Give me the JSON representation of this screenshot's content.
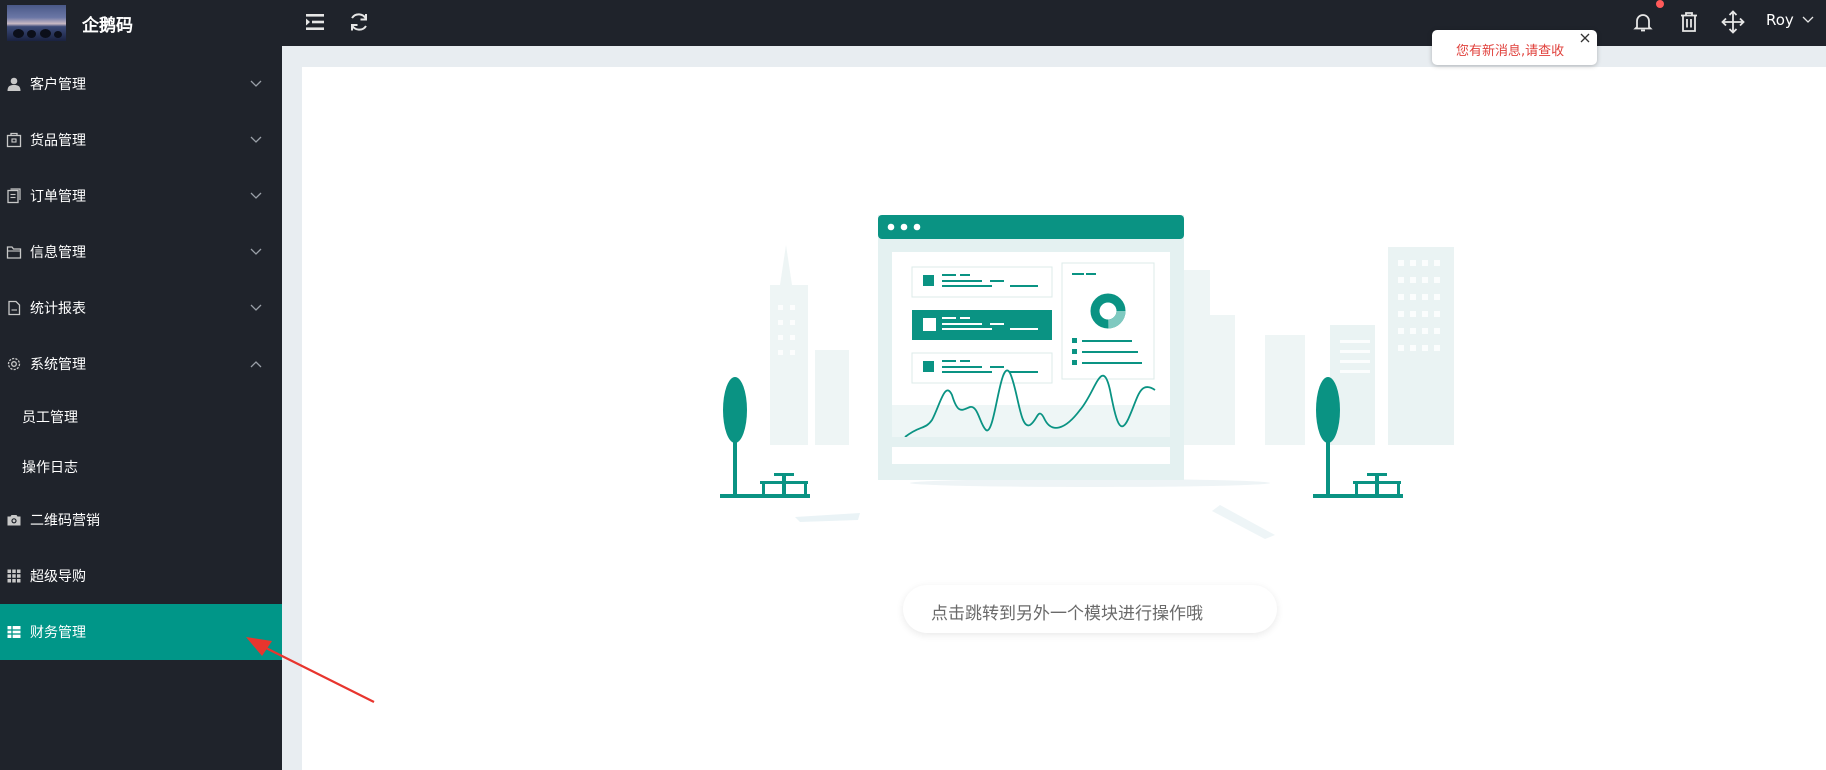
{
  "app": {
    "logo_title": "企鹅码"
  },
  "sidebar": {
    "items": [
      {
        "label": "客户管理",
        "icon": "user-icon",
        "expanded": false
      },
      {
        "label": "货品管理",
        "icon": "package-icon",
        "expanded": false
      },
      {
        "label": "订单管理",
        "icon": "order-icon",
        "expanded": false
      },
      {
        "label": "信息管理",
        "icon": "folder-icon",
        "expanded": false
      },
      {
        "label": "统计报表",
        "icon": "report-icon",
        "expanded": false
      },
      {
        "label": "系统管理",
        "icon": "gear-icon",
        "expanded": true,
        "children": [
          {
            "label": "员工管理"
          },
          {
            "label": "操作日志"
          }
        ]
      },
      {
        "label": "二维码营销",
        "icon": "camera-icon",
        "expanded": false
      },
      {
        "label": "超级导购",
        "icon": "grid-icon",
        "expanded": false
      },
      {
        "label": "财务管理",
        "icon": "table-icon",
        "expanded": false,
        "active": true
      }
    ]
  },
  "topbar": {
    "user_name": "Roy",
    "has_unread": true
  },
  "notice": {
    "text": "您有新消息,请查收"
  },
  "main": {
    "hint": "点击跳转到另外一个模块进行操作哦"
  },
  "colors": {
    "sidebar_bg": "#1f232b",
    "accent": "#009688",
    "notice_text": "#e0413c",
    "arrow": "#e8352e"
  }
}
